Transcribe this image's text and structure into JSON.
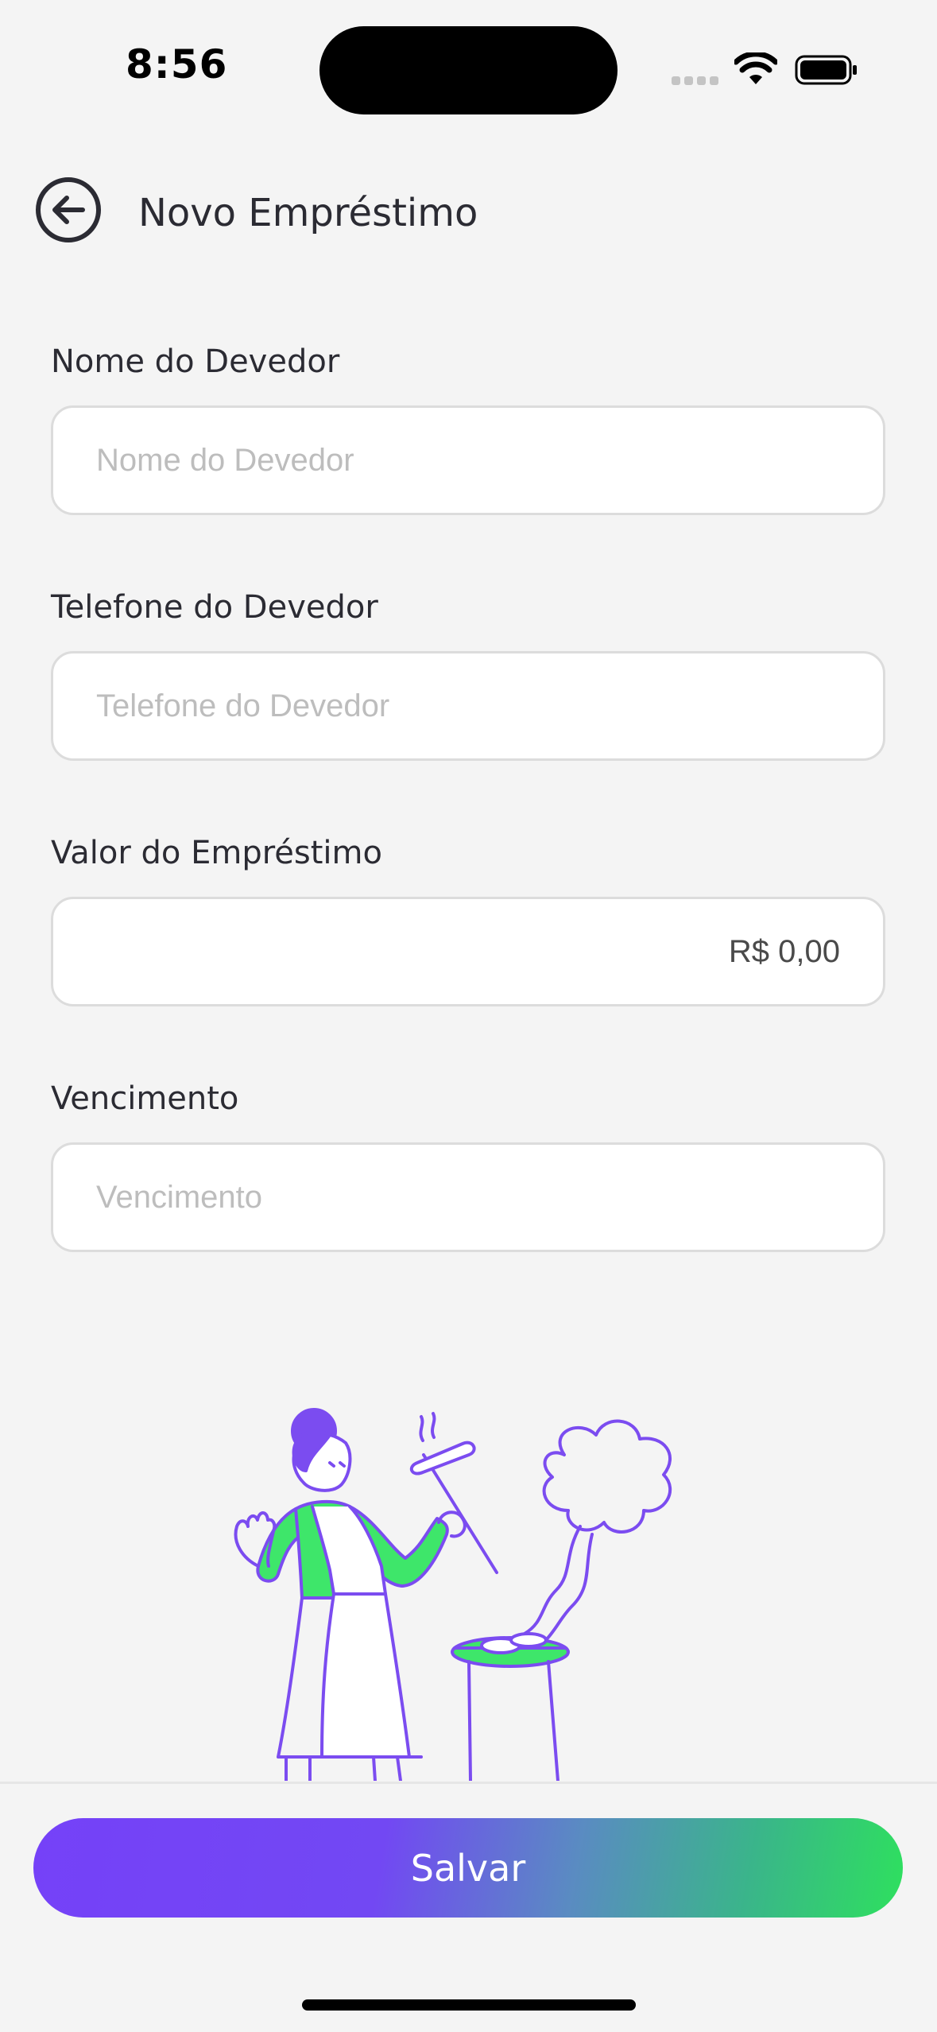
{
  "status_bar": {
    "time": "8:56",
    "wifi_icon": "wifi-icon",
    "battery_icon": "battery-icon"
  },
  "header": {
    "back_icon": "arrow-left-circle-icon",
    "title": "Novo Empréstimo"
  },
  "form": {
    "debtor_name": {
      "label": "Nome do Devedor",
      "placeholder": "Nome do Devedor",
      "value": ""
    },
    "debtor_phone": {
      "label": "Telefone do Devedor",
      "placeholder": "Telefone do Devedor",
      "value": ""
    },
    "loan_amount": {
      "label": "Valor do Empréstimo",
      "value": "R$ 0,00"
    },
    "due_date": {
      "label": "Vencimento",
      "placeholder": "Vencimento",
      "value": ""
    }
  },
  "illustration": {
    "icon": "barbecue-illustration"
  },
  "actions": {
    "save_label": "Salvar"
  },
  "colors": {
    "accent_purple": "#7541F8",
    "accent_green": "#2EE05E",
    "background": "#F4F4F4"
  }
}
